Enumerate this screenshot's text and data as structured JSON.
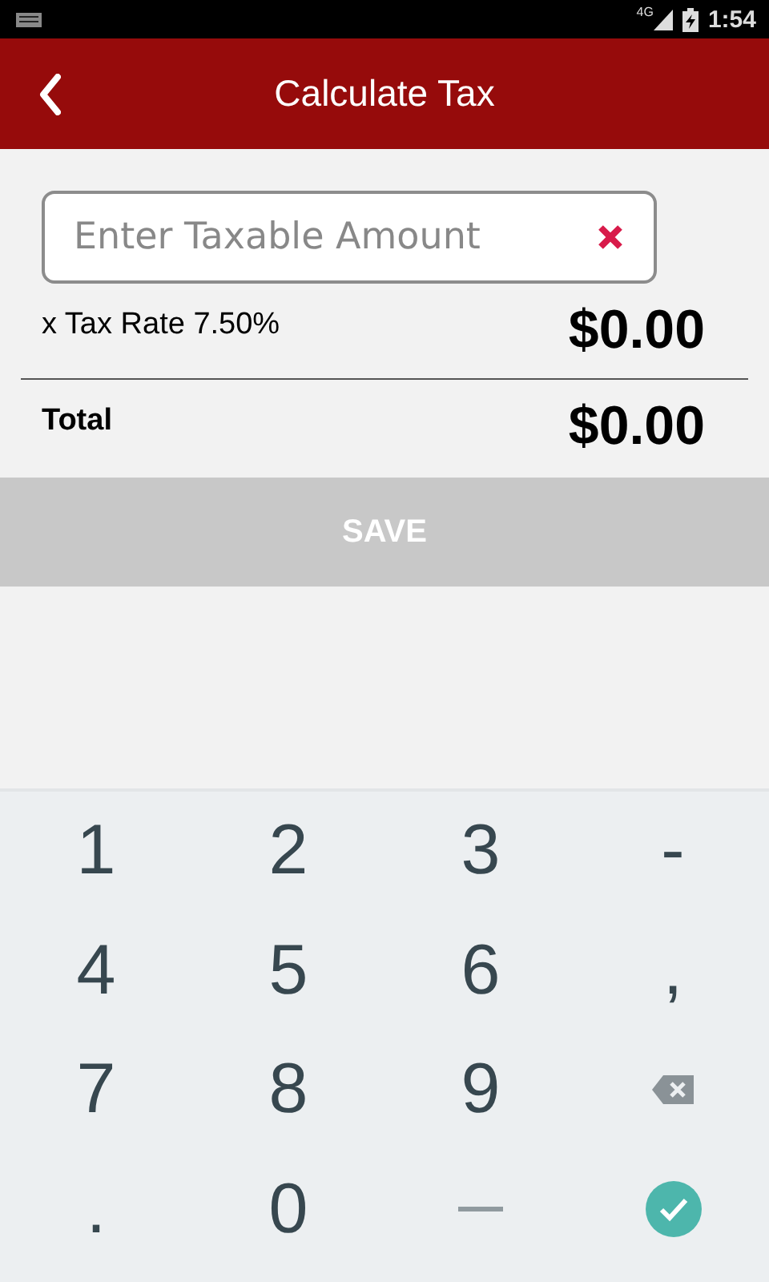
{
  "status_bar": {
    "network": "4G",
    "time": "1:54"
  },
  "app_bar": {
    "title": "Calculate Tax"
  },
  "amount_field": {
    "placeholder": "Enter Taxable Amount"
  },
  "tax_row": {
    "label": "x Tax Rate 7.50%",
    "value": "$0.00"
  },
  "total_row": {
    "label": "Total",
    "value": "$0.00"
  },
  "save_button": {
    "label": "SAVE",
    "disabled": true
  },
  "keypad": [
    {
      "kind": "text",
      "label": "1"
    },
    {
      "kind": "text",
      "label": "2"
    },
    {
      "kind": "text",
      "label": "3"
    },
    {
      "kind": "text",
      "label": "-"
    },
    {
      "kind": "text",
      "label": "4"
    },
    {
      "kind": "text",
      "label": "5"
    },
    {
      "kind": "text",
      "label": "6"
    },
    {
      "kind": "text",
      "label": ","
    },
    {
      "kind": "text",
      "label": "7"
    },
    {
      "kind": "text",
      "label": "8"
    },
    {
      "kind": "text",
      "label": "9"
    },
    {
      "kind": "backspace"
    },
    {
      "kind": "text",
      "label": "."
    },
    {
      "kind": "text",
      "label": "0"
    },
    {
      "kind": "space"
    },
    {
      "kind": "done"
    }
  ]
}
